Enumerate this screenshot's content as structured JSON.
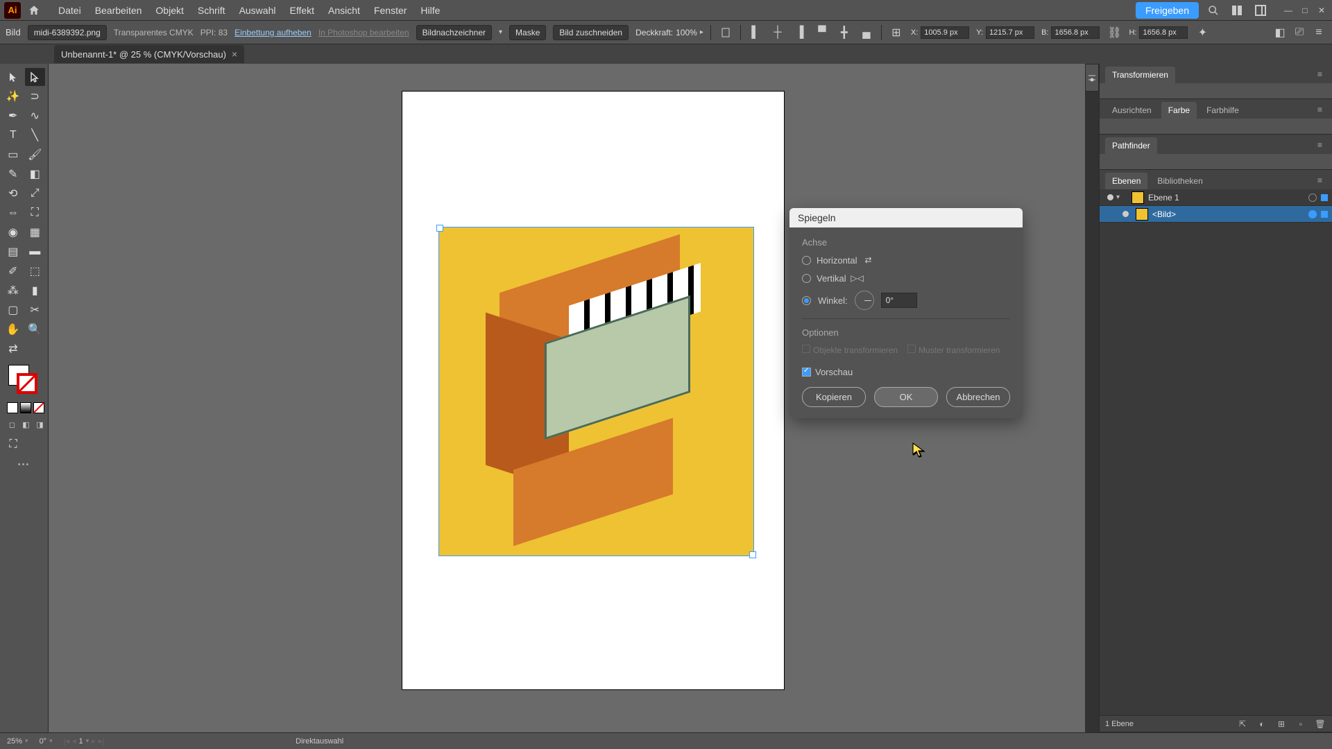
{
  "menu": {
    "items": [
      "Datei",
      "Bearbeiten",
      "Objekt",
      "Schrift",
      "Auswahl",
      "Effekt",
      "Ansicht",
      "Fenster",
      "Hilfe"
    ],
    "share": "Freigeben"
  },
  "control": {
    "type_label": "Bild",
    "filename": "midi-6389392.png",
    "color_mode": "Transparentes CMYK",
    "ppi": "PPI: 83",
    "unembed": "Einbettung aufheben",
    "edit_ps": "In Photoshop bearbeiten",
    "trace": "Bildnachzeichner",
    "mask": "Maske",
    "crop": "Bild zuschneiden",
    "opacity_label": "Deckkraft:",
    "opacity_value": "100%",
    "x_label": "X:",
    "x_value": "1005.9 px",
    "y_label": "Y:",
    "y_value": "1215.7 px",
    "w_label": "B:",
    "w_value": "1656.8 px",
    "h_label": "H:",
    "h_value": "1656.8 px"
  },
  "tab": {
    "title": "Unbenannt-1* @ 25 % (CMYK/Vorschau)"
  },
  "panels": {
    "transform": "Transformieren",
    "align": "Ausrichten",
    "color": "Farbe",
    "guide": "Farbhilfe",
    "pathfinder": "Pathfinder",
    "layers": "Ebenen",
    "libraries": "Bibliotheken"
  },
  "layers": {
    "layer1": "Ebene 1",
    "item1": "<Bild>",
    "footer": "1 Ebene"
  },
  "dialog": {
    "title": "Spiegeln",
    "axis_label": "Achse",
    "horizontal": "Horizontal",
    "vertical": "Vertikal",
    "angle_label": "Winkel:",
    "angle_value": "0°",
    "options_label": "Optionen",
    "transform_objects": "Objekte transformieren",
    "transform_patterns": "Muster transformieren",
    "preview": "Vorschau",
    "copy_btn": "Kopieren",
    "ok_btn": "OK",
    "cancel_btn": "Abbrechen"
  },
  "status": {
    "zoom": "25%",
    "rotation": "0°",
    "artboard": "1",
    "tool": "Direktauswahl"
  }
}
